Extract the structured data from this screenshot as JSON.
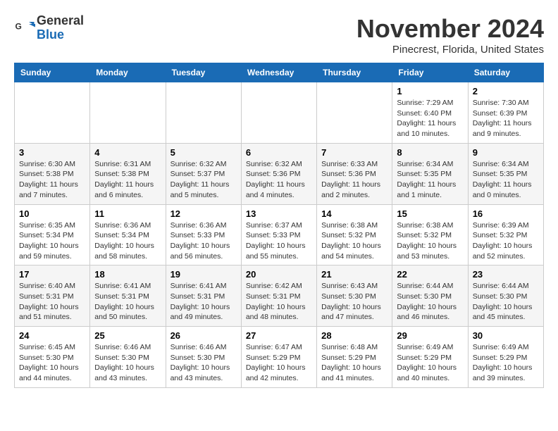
{
  "header": {
    "logo_line1": "General",
    "logo_line2": "Blue",
    "month_year": "November 2024",
    "location": "Pinecrest, Florida, United States"
  },
  "weekdays": [
    "Sunday",
    "Monday",
    "Tuesday",
    "Wednesday",
    "Thursday",
    "Friday",
    "Saturday"
  ],
  "weeks": [
    [
      {
        "day": "",
        "info": ""
      },
      {
        "day": "",
        "info": ""
      },
      {
        "day": "",
        "info": ""
      },
      {
        "day": "",
        "info": ""
      },
      {
        "day": "",
        "info": ""
      },
      {
        "day": "1",
        "info": "Sunrise: 7:29 AM\nSunset: 6:40 PM\nDaylight: 11 hours and 10 minutes."
      },
      {
        "day": "2",
        "info": "Sunrise: 7:30 AM\nSunset: 6:39 PM\nDaylight: 11 hours and 9 minutes."
      }
    ],
    [
      {
        "day": "3",
        "info": "Sunrise: 6:30 AM\nSunset: 5:38 PM\nDaylight: 11 hours and 7 minutes."
      },
      {
        "day": "4",
        "info": "Sunrise: 6:31 AM\nSunset: 5:38 PM\nDaylight: 11 hours and 6 minutes."
      },
      {
        "day": "5",
        "info": "Sunrise: 6:32 AM\nSunset: 5:37 PM\nDaylight: 11 hours and 5 minutes."
      },
      {
        "day": "6",
        "info": "Sunrise: 6:32 AM\nSunset: 5:36 PM\nDaylight: 11 hours and 4 minutes."
      },
      {
        "day": "7",
        "info": "Sunrise: 6:33 AM\nSunset: 5:36 PM\nDaylight: 11 hours and 2 minutes."
      },
      {
        "day": "8",
        "info": "Sunrise: 6:34 AM\nSunset: 5:35 PM\nDaylight: 11 hours and 1 minute."
      },
      {
        "day": "9",
        "info": "Sunrise: 6:34 AM\nSunset: 5:35 PM\nDaylight: 11 hours and 0 minutes."
      }
    ],
    [
      {
        "day": "10",
        "info": "Sunrise: 6:35 AM\nSunset: 5:34 PM\nDaylight: 10 hours and 59 minutes."
      },
      {
        "day": "11",
        "info": "Sunrise: 6:36 AM\nSunset: 5:34 PM\nDaylight: 10 hours and 58 minutes."
      },
      {
        "day": "12",
        "info": "Sunrise: 6:36 AM\nSunset: 5:33 PM\nDaylight: 10 hours and 56 minutes."
      },
      {
        "day": "13",
        "info": "Sunrise: 6:37 AM\nSunset: 5:33 PM\nDaylight: 10 hours and 55 minutes."
      },
      {
        "day": "14",
        "info": "Sunrise: 6:38 AM\nSunset: 5:32 PM\nDaylight: 10 hours and 54 minutes."
      },
      {
        "day": "15",
        "info": "Sunrise: 6:38 AM\nSunset: 5:32 PM\nDaylight: 10 hours and 53 minutes."
      },
      {
        "day": "16",
        "info": "Sunrise: 6:39 AM\nSunset: 5:32 PM\nDaylight: 10 hours and 52 minutes."
      }
    ],
    [
      {
        "day": "17",
        "info": "Sunrise: 6:40 AM\nSunset: 5:31 PM\nDaylight: 10 hours and 51 minutes."
      },
      {
        "day": "18",
        "info": "Sunrise: 6:41 AM\nSunset: 5:31 PM\nDaylight: 10 hours and 50 minutes."
      },
      {
        "day": "19",
        "info": "Sunrise: 6:41 AM\nSunset: 5:31 PM\nDaylight: 10 hours and 49 minutes."
      },
      {
        "day": "20",
        "info": "Sunrise: 6:42 AM\nSunset: 5:31 PM\nDaylight: 10 hours and 48 minutes."
      },
      {
        "day": "21",
        "info": "Sunrise: 6:43 AM\nSunset: 5:30 PM\nDaylight: 10 hours and 47 minutes."
      },
      {
        "day": "22",
        "info": "Sunrise: 6:44 AM\nSunset: 5:30 PM\nDaylight: 10 hours and 46 minutes."
      },
      {
        "day": "23",
        "info": "Sunrise: 6:44 AM\nSunset: 5:30 PM\nDaylight: 10 hours and 45 minutes."
      }
    ],
    [
      {
        "day": "24",
        "info": "Sunrise: 6:45 AM\nSunset: 5:30 PM\nDaylight: 10 hours and 44 minutes."
      },
      {
        "day": "25",
        "info": "Sunrise: 6:46 AM\nSunset: 5:30 PM\nDaylight: 10 hours and 43 minutes."
      },
      {
        "day": "26",
        "info": "Sunrise: 6:46 AM\nSunset: 5:30 PM\nDaylight: 10 hours and 43 minutes."
      },
      {
        "day": "27",
        "info": "Sunrise: 6:47 AM\nSunset: 5:29 PM\nDaylight: 10 hours and 42 minutes."
      },
      {
        "day": "28",
        "info": "Sunrise: 6:48 AM\nSunset: 5:29 PM\nDaylight: 10 hours and 41 minutes."
      },
      {
        "day": "29",
        "info": "Sunrise: 6:49 AM\nSunset: 5:29 PM\nDaylight: 10 hours and 40 minutes."
      },
      {
        "day": "30",
        "info": "Sunrise: 6:49 AM\nSunset: 5:29 PM\nDaylight: 10 hours and 39 minutes."
      }
    ]
  ]
}
